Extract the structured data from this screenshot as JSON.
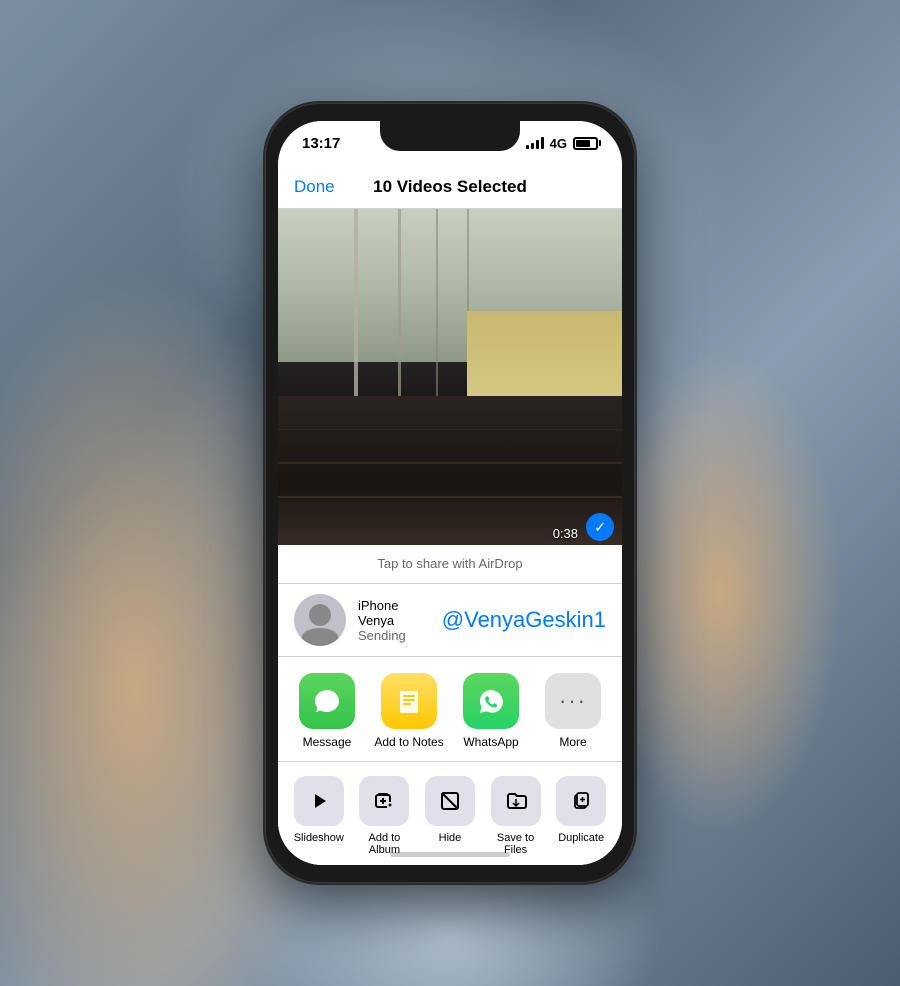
{
  "background": {
    "color": "#6a7a8a"
  },
  "phone": {
    "status_bar": {
      "time": "13:17",
      "signal": "4G",
      "battery_percent": 75
    },
    "nav_bar": {
      "done_label": "Done",
      "title": "10 Videos Selected"
    },
    "preview": {
      "video_duration": "0:38",
      "has_checkmark": true
    },
    "share_sheet": {
      "airdrop_hint": "Tap to share with AirDrop",
      "contact": {
        "name": "iPhone Venya",
        "status": "Sending",
        "airdrop_name": "@VenyaGeskin1"
      },
      "apps": [
        {
          "id": "message",
          "label": "Message",
          "icon": "💬"
        },
        {
          "id": "notes",
          "label": "Add to Notes",
          "icon": "📝"
        },
        {
          "id": "whatsapp",
          "label": "WhatsApp",
          "icon": "📱"
        },
        {
          "id": "more",
          "label": "More",
          "icon": "···"
        }
      ],
      "actions": [
        {
          "id": "slideshow",
          "label": "Slideshow",
          "icon": "▶"
        },
        {
          "id": "add-album",
          "label": "Add to Album",
          "icon": "+"
        },
        {
          "id": "hide",
          "label": "Hide",
          "icon": "🚫"
        },
        {
          "id": "save-files",
          "label": "Save to Files",
          "icon": "📁"
        },
        {
          "id": "duplicate",
          "label": "Duplicate",
          "icon": "+"
        }
      ]
    }
  }
}
